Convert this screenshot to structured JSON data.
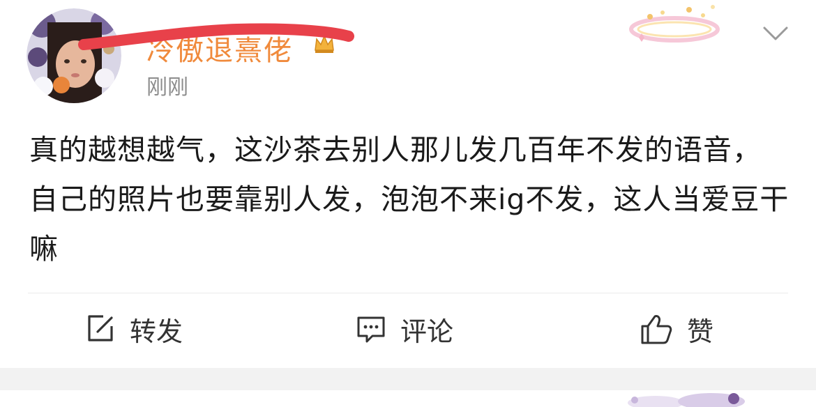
{
  "post": {
    "username": "冷傲退熹佬",
    "timestamp": "刚刚",
    "content": "真的越想越气，这沙茶去别人那儿发几百年不发的语音，自己的照片也要靠别人发，泡泡不来ig不发，这人当爱豆干嘛"
  },
  "actions": {
    "repost_label": "转发",
    "comment_label": "评论",
    "like_label": "赞"
  },
  "colors": {
    "username": "#f08a3c",
    "redaction": "#e8414a",
    "timestamp": "#8c8c8c",
    "text": "#1a1a1a",
    "icon": "#333333",
    "separator_band": "#f2f2f2"
  },
  "icons": {
    "repost": "edit-square-icon",
    "comment": "chat-bubble-icon",
    "like": "thumbs-up-icon",
    "dropdown": "chevron-down-icon",
    "badge": "decorative-badge-icon",
    "crown": "crown-icon"
  }
}
